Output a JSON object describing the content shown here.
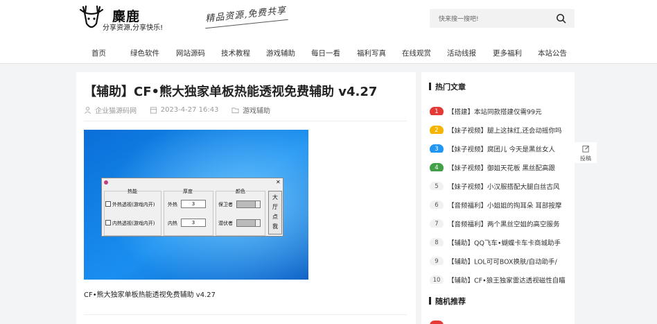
{
  "site": {
    "name": "麋鹿",
    "tagline": "分享资源,分享快乐!",
    "slogan": "精品资源,免费共享"
  },
  "search": {
    "placeholder": "快来搜一搜吧!"
  },
  "nav": [
    "首页",
    "绿色软件",
    "网站源码",
    "技术教程",
    "游戏辅助",
    "每日一看",
    "福利写真",
    "在线观赏",
    "活动线报",
    "更多福利",
    "本站公告"
  ],
  "article": {
    "title": "【辅助】CF•熊大独家单板热能透视免费辅助 v4.27",
    "author": "企业猫源码网",
    "date": "2023-4-27 16:43",
    "category": "游戏辅助",
    "caption": "CF•熊大独家单板热能透视免费辅助 v4.27",
    "dialog": {
      "col_hot": "热能",
      "col_thick": "厚度",
      "col_color": "颜色",
      "chk_outer": "外热透视(游戏内开)",
      "chk_inner": "内热透视(游戏内开)",
      "lbl_outer": "外热",
      "lbl_inner": "内热",
      "val_outer": "3",
      "val_inner": "3",
      "lbl_guard": "保卫者",
      "lbl_lurker": "潜伏者",
      "close": "✕",
      "btn": [
        "大",
        "厅",
        "点",
        "我"
      ]
    }
  },
  "sidebar": {
    "hot_title": "热门文章",
    "hot": [
      {
        "n": "1",
        "text": "【搭建】本站同款搭建仅需99元",
        "color": "#e53935"
      },
      {
        "n": "2",
        "text": "【妹子视频】腿上这抹红,还会动摇你吗",
        "color": "#f4b400"
      },
      {
        "n": "3",
        "text": "【妹子视频】腐团儿 今天是黑丝女人",
        "color": "#2196f3"
      },
      {
        "n": "4",
        "text": "【妹子视频】御姐天花板 黑丝配高跟",
        "color": "#43a047"
      },
      {
        "n": "5",
        "text": "【妹子视频】小汉服搭配大腿白丝古风",
        "color": ""
      },
      {
        "n": "6",
        "text": "【音频福利】小姐姐的掏耳朵 耳部按摩",
        "color": ""
      },
      {
        "n": "7",
        "text": "【音频福利】两个黑丝空姐的高空服务",
        "color": ""
      },
      {
        "n": "8",
        "text": "【辅助】QQ飞车•蝴蝶卡车卡商城助手",
        "color": ""
      },
      {
        "n": "9",
        "text": "【辅助】LOL可可BOX换肤/自动助手/",
        "color": ""
      },
      {
        "n": "10",
        "text": "【辅助】CF•狼王独家雷达透视磁性自瞄",
        "color": ""
      }
    ],
    "random_title": "随机推荐"
  },
  "float_btn": {
    "label": "投稿"
  }
}
